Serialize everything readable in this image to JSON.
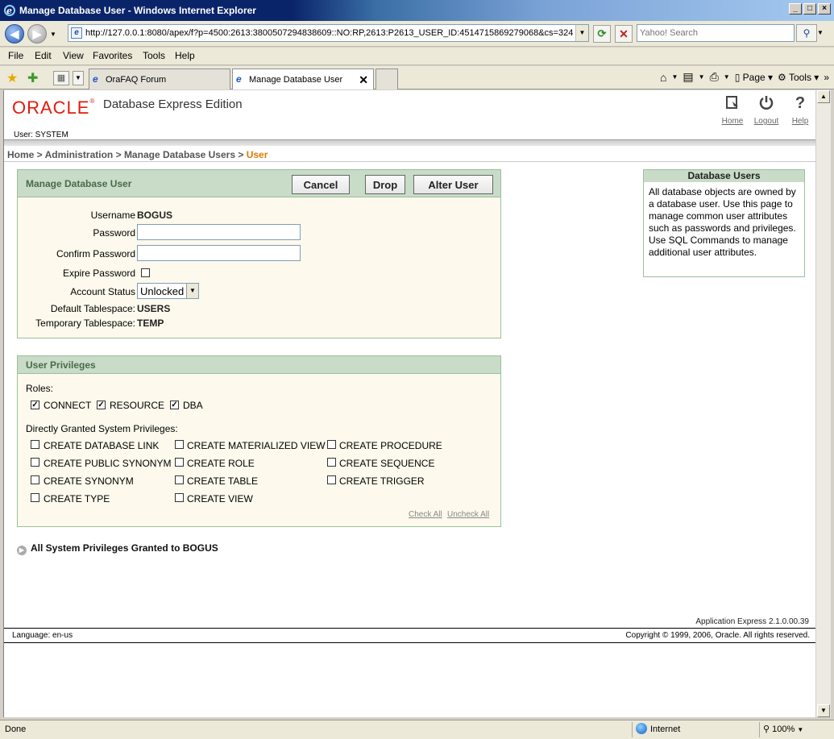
{
  "window": {
    "title": "Manage Database User - Windows Internet Explorer"
  },
  "address": {
    "url": "http://127.0.0.1:8080/apex/f?p=4500:2613:3800507294838609::NO:RP,2613:P2613_USER_ID:4514715869279068&cs=324",
    "search_placeholder": "Yahoo! Search"
  },
  "menu": [
    "File",
    "Edit",
    "View",
    "Favorites",
    "Tools",
    "Help"
  ],
  "tabs": {
    "orafaq": "OraFAQ Forum",
    "manage": "Manage Database User"
  },
  "toolbar": {
    "page": "Page",
    "tools": "Tools"
  },
  "header": {
    "logo": "ORACLE",
    "product": "Database Express Edition",
    "user": "User: SYSTEM",
    "home": "Home",
    "logout": "Logout",
    "help": "Help"
  },
  "breadcrumb": {
    "home": "Home",
    "administration": "Administration",
    "manage_users": "Manage Database Users",
    "current": "User",
    "sep": " > "
  },
  "manage": {
    "title": "Manage Database User",
    "cancel": "Cancel",
    "drop": "Drop",
    "alter": "Alter User",
    "username_label": "Username",
    "username": "BOGUS",
    "password_label": "Password",
    "confirm_label": "Confirm Password",
    "expire_label": "Expire Password",
    "status_label": "Account Status",
    "status_value": "Unlocked",
    "default_ts_label": "Default Tablespace:",
    "default_ts": "USERS",
    "temp_ts_label": "Temporary Tablespace:",
    "temp_ts": "TEMP"
  },
  "privileges": {
    "title": "User Privileges",
    "roles_label": "Roles:",
    "roles": [
      {
        "name": "CONNECT",
        "checked": true
      },
      {
        "name": "RESOURCE",
        "checked": true
      },
      {
        "name": "DBA",
        "checked": true
      }
    ],
    "sys_label": "Directly Granted System Privileges:",
    "sys_privs": [
      "CREATE DATABASE LINK",
      "CREATE MATERIALIZED VIEW",
      "CREATE PROCEDURE",
      "CREATE PUBLIC SYNONYM",
      "CREATE ROLE",
      "CREATE SEQUENCE",
      "CREATE SYNONYM",
      "CREATE TABLE",
      "CREATE TRIGGER",
      "CREATE TYPE",
      "CREATE VIEW"
    ],
    "check_all": "Check All",
    "uncheck_all": "Uncheck All"
  },
  "all_privs": "All System Privileges Granted to BOGUS",
  "side": {
    "title": "Database Users",
    "body": "All database objects are owned by a database user. Use this page to manage common user attributes such as passwords and privileges. Use SQL Commands to manage additional user attributes."
  },
  "footer": {
    "version": "Application Express 2.1.0.00.39",
    "language": "Language: en-us",
    "copyright": "Copyright © 1999, 2006, Oracle. All rights reserved."
  },
  "status": {
    "text": "Done",
    "zone": "Internet",
    "zoom": "100%"
  }
}
